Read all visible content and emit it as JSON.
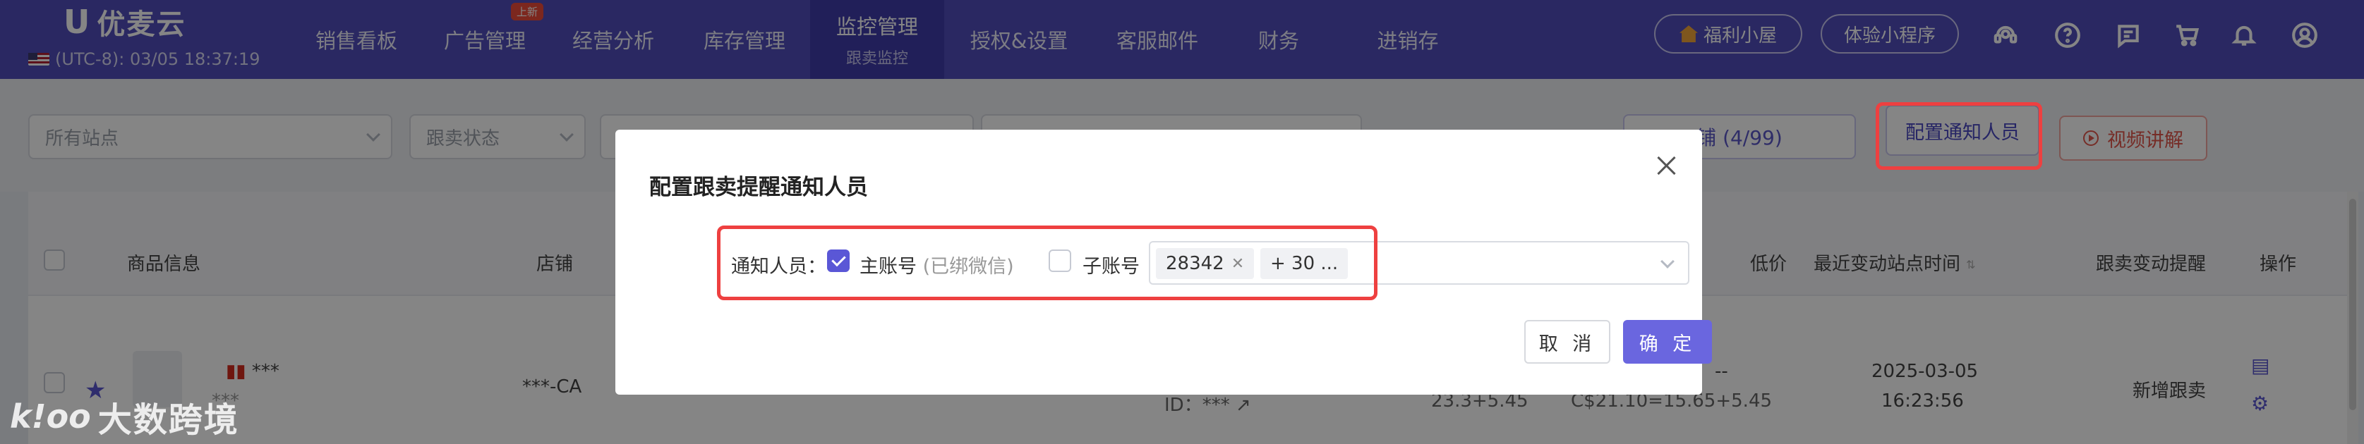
{
  "app": {
    "logo_mark": "U",
    "name": "优麦云",
    "clock": "(UTC-8): 03/05 18:37:19"
  },
  "nav": {
    "items": [
      {
        "label": "销售看板"
      },
      {
        "label": "广告管理",
        "badge": "上新"
      },
      {
        "label": "经营分析"
      },
      {
        "label": "库存管理"
      },
      {
        "label": "监控管理",
        "sub": "跟卖监控",
        "active": true
      },
      {
        "label": "授权&设置"
      },
      {
        "label": "客服邮件"
      },
      {
        "label": "财务"
      },
      {
        "label": "进销存"
      }
    ],
    "welfare_btn": "福利小屋",
    "miniprogram_btn": "体验小程序",
    "icons": [
      "support-agent-icon",
      "help-icon",
      "message-icon",
      "cart-icon",
      "bell-icon",
      "avatar-icon"
    ]
  },
  "filters": {
    "site_placeholder": "所有站点",
    "status_placeholder": "跟卖状态",
    "monitor_count": "铺  (4/99)",
    "config_btn": "配置通知人员",
    "video_btn": "视频讲解"
  },
  "table": {
    "headers": {
      "product": "商品信息",
      "store": "店铺",
      "lowest_price": "低价",
      "last_change_time": "最近变动站点时间",
      "alert": "跟卖变动提醒",
      "actions": "操作"
    },
    "row": {
      "name": "***",
      "sub": "***",
      "store": "***-CA",
      "id_label": "ID：***",
      "price_main": "23.3+5.45",
      "price_dash": "--",
      "price_total": "C$21.10=15.65+5.45",
      "date": "2025-03-05",
      "time": "16:23:56",
      "alert": "新增跟卖"
    }
  },
  "modal": {
    "title": "配置跟卖提醒通知人员",
    "notify_label": "通知人员：",
    "main_account": "主账号",
    "main_hint": "(已绑微信)",
    "sub_account": "子账号",
    "tags": [
      "28342",
      "+ 30 ..."
    ],
    "cancel": "取 消",
    "confirm": "确 定"
  },
  "watermark": {
    "mark": "k!oo",
    "text": "大数跨境"
  },
  "colors": {
    "nav_bg": "#514dbd",
    "accent": "#6a66df",
    "highlight": "#ee4040"
  }
}
